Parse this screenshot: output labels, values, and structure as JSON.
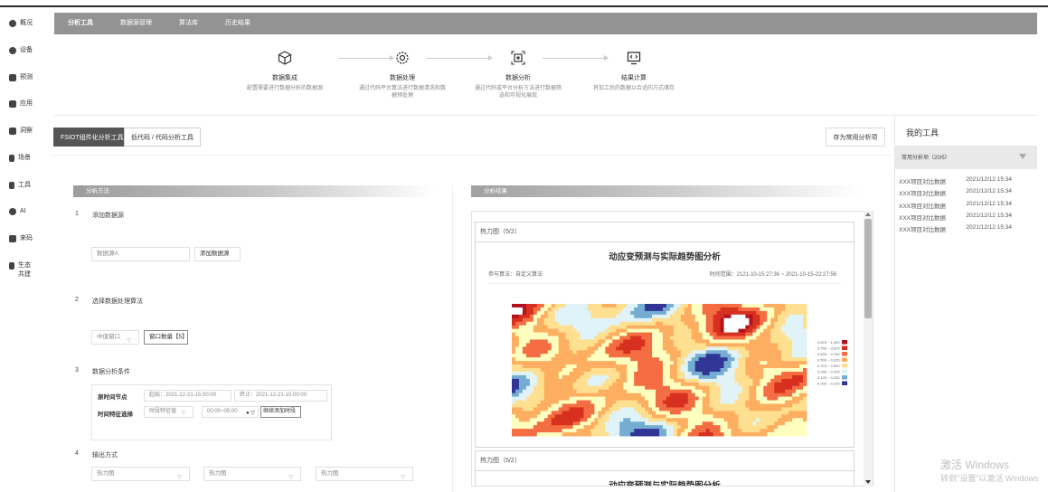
{
  "sidebar": {
    "items": [
      {
        "label": "概况",
        "icon": "dashboard-icon"
      },
      {
        "label": "设备",
        "icon": "device-icon"
      },
      {
        "label": "预测",
        "icon": "forecast-icon"
      },
      {
        "label": "应用",
        "icon": "app-icon"
      },
      {
        "label": "洞察",
        "icon": "insight-icon"
      },
      {
        "label": "场景",
        "icon": "scene-icon"
      },
      {
        "label": "工具",
        "icon": "tool-icon"
      },
      {
        "label": "AI",
        "icon": "ai-icon"
      },
      {
        "label": "来码",
        "icon": "code-icon"
      },
      {
        "label": "生态共建",
        "icon": "ecosystem-icon"
      }
    ]
  },
  "topnav": {
    "tabs": [
      {
        "label": "分析工具",
        "active": true
      },
      {
        "label": "数据源管理",
        "active": false
      },
      {
        "label": "算法库",
        "active": false
      },
      {
        "label": "历史结果",
        "active": false
      }
    ]
  },
  "workflow": {
    "steps": [
      {
        "title": "数据集成",
        "desc": "配置需要进行数据分析的数据源",
        "icon": "cube-icon"
      },
      {
        "title": "数据处理",
        "desc": "通过代码平台算法进行数据清洗和数据预处理",
        "icon": "gear-icon"
      },
      {
        "title": "数据分析",
        "desc": "通过代码或平台分析方法进行数据筛选和可视化展现",
        "icon": "analysis-chip-icon"
      },
      {
        "title": "结果计算",
        "desc": "将加工后的数据以合适的方式储存",
        "icon": "monitor-code-icon"
      }
    ]
  },
  "tool_tabs": [
    {
      "label": "FSIOT组件化分析工具",
      "active": true
    },
    {
      "label": "低代码 / 代码分析工具",
      "active": false
    }
  ],
  "save_button": "存为常用分析项",
  "left": {
    "section_title": "分析方法",
    "steps": [
      {
        "num": "1",
        "title": "添加数据源"
      },
      {
        "num": "2",
        "title": "选择数据处理算法"
      },
      {
        "num": "3",
        "title": "数据分析条件"
      },
      {
        "num": "4",
        "title": "输出方式"
      }
    ],
    "datasource_placeholder": "数据源A",
    "add_datasource": "添加数据源",
    "algo_select": "中值窗口",
    "window_size": "窗口数量【5】",
    "time_start_label": "原时间节点",
    "time_start_value": "起始：2021-12-21-15:00:00",
    "time_end_value": "终止：2021-12-21-15:00:00",
    "time_feature_label": "时间特征选择",
    "time_feature_select": "时段特征值",
    "time_range_select": "00:00~05:00",
    "add_time_button": "继续添加时段",
    "output_selects": [
      "热力图",
      "热力图",
      "热力图"
    ]
  },
  "result": {
    "section_title": "分析结果",
    "cards": [
      {
        "header": "热力图（5/2）",
        "title": "动应变预测与实际趋势图分析",
        "algo": "参与算法：自定义算法",
        "time_range": "时间范围：2121-10-15:27:36 ~ 2021-10-15-22:27:56"
      },
      {
        "header": "热力图（5/2）",
        "title": "动应变预测与实际趋势图分析"
      }
    ],
    "legend": [
      {
        "label": "0.875 ~ 1.000",
        "color": "#b3101f"
      },
      {
        "label": "0.750 ~ 0.875",
        "color": "#d7301f"
      },
      {
        "label": "0.625 ~ 0.750",
        "color": "#f46d43"
      },
      {
        "label": "0.500 ~ 0.625",
        "color": "#fdae61"
      },
      {
        "label": "0.375 ~ 0.500",
        "color": "#fee090"
      },
      {
        "label": "0.250 ~ 0.375",
        "color": "#e0f3f8"
      },
      {
        "label": "0.125 ~ 0.250",
        "color": "#74add1"
      },
      {
        "label": "0.000 ~ 0.125",
        "color": "#313695"
      }
    ]
  },
  "my_tools": {
    "title": "我的工具",
    "dropdown": "常用分析项（20/5）",
    "items": [
      {
        "name": "XXX项目对比数据",
        "time": "2021/12/12 15:34"
      },
      {
        "name": "XXX项目对比数据",
        "time": "2021/12/12 15:34"
      },
      {
        "name": "XXX项目对比数据",
        "time": "2021/12/12 15:34"
      },
      {
        "name": "XXX项目对比数据",
        "time": "2021/12/12 15:34"
      },
      {
        "name": "XXX项目对比数据",
        "time": "2021/12/12 15:34"
      }
    ]
  },
  "watermark": {
    "line1": "激活 Windows",
    "line2": "转到\"设置\"以激活 Windows"
  }
}
